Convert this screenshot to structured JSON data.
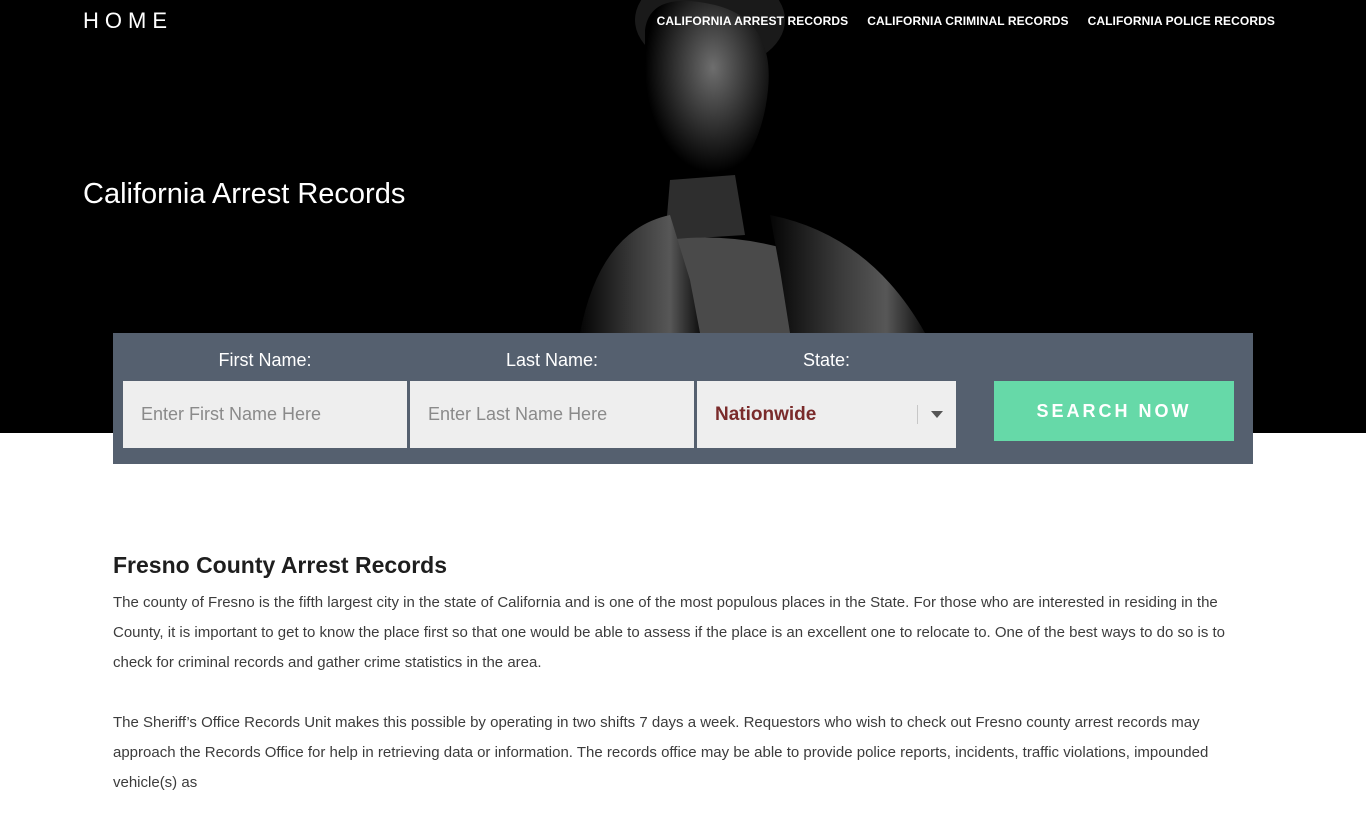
{
  "header": {
    "logo": "HOME",
    "nav": [
      "CALIFORNIA ARREST RECORDS",
      "CALIFORNIA CRIMINAL RECORDS",
      "CALIFORNIA POLICE RECORDS"
    ]
  },
  "hero": {
    "title": "California Arrest Records"
  },
  "search": {
    "first_name_label": "First Name:",
    "first_name_placeholder": "Enter First Name Here",
    "last_name_label": "Last Name:",
    "last_name_placeholder": "Enter Last Name Here",
    "state_label": "State:",
    "state_value": "Nationwide",
    "button_label": "SEARCH NOW"
  },
  "article": {
    "heading": "Fresno County Arrest Records",
    "paragraphs": [
      "The county of Fresno is the fifth largest city in the state of California and is one of the most populous places in the State. For those who are interested in residing in the County, it is important to get to know the place first so that one would be able to assess if the place is an excellent one to relocate to. One of the best ways to do so is to check for criminal records and gather crime statistics in the area.",
      "The Sheriff’s Office Records Unit makes this possible by operating in two shifts 7 days a week. Requestors who wish to check out Fresno county arrest records may approach the Records Office for help in retrieving data or information. The records office may be able to provide police reports, incidents, traffic violations, impounded vehicle(s) as"
    ]
  },
  "colors": {
    "hero_bg": "#000000",
    "panel_bg": "#55606f",
    "button_bg": "#66d9a8",
    "state_text": "#7a2b2b"
  }
}
